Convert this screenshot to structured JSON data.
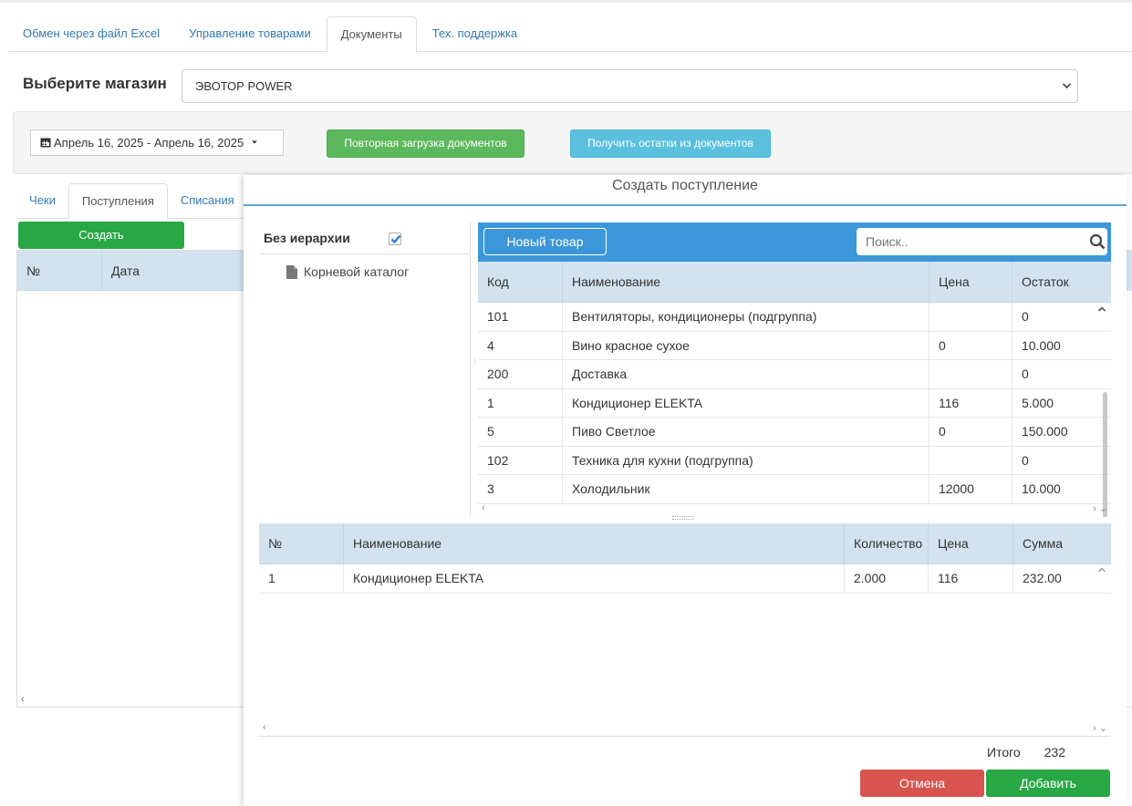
{
  "top_tabs": [
    "Обмен через файл Excel",
    "Управление товарами",
    "Документы",
    "Тех. поддержка"
  ],
  "shop": {
    "label": "Выберите магазин",
    "selected": "ЭВОТОР POWER"
  },
  "filter": {
    "date_range": "Апрель 16, 2025 - Апрель 16, 2025",
    "reload_button": "Повторная загрузка документов",
    "stock_button": "Получить остатки из документов"
  },
  "doc_tabs": [
    "Чеки",
    "Поступления",
    "Списания"
  ],
  "create_button": "Создать",
  "left_grid": {
    "columns": [
      "№",
      "Дата"
    ]
  },
  "modal": {
    "title": "Создать поступление",
    "tree": {
      "no_hierarchy": "Без иерархии",
      "root": "Корневой каталог"
    },
    "new_product_button": "Новый товар",
    "search_placeholder": "Поиск..",
    "product_columns": [
      "Код",
      "Наименование",
      "Цена",
      "Остаток"
    ],
    "products": [
      [
        "101",
        "Вентиляторы, кондиционеры (подгруппа)",
        "",
        "0"
      ],
      [
        "4",
        "Вино красное сухое",
        "0",
        "10.000"
      ],
      [
        "200",
        "Доставка",
        "",
        "0"
      ],
      [
        "1",
        "Кондиционер ELEKTA",
        "116",
        "5.000"
      ],
      [
        "5",
        "Пиво Светлое",
        "0",
        "150.000"
      ],
      [
        "102",
        "Техника для кухни (подгруппа)",
        "",
        "0"
      ],
      [
        "3",
        "Холодильник",
        "12000",
        "10.000"
      ]
    ],
    "selected_columns": [
      "№",
      "Наименование",
      "Количество",
      "Цена",
      "Сумма"
    ],
    "selected_rows": [
      [
        "1",
        "Кондиционер ELEKTA",
        "2.000",
        "116",
        "232.00"
      ]
    ],
    "total_label": "Итого",
    "total_value": "232",
    "cancel_button": "Отмена",
    "add_button": "Добавить"
  },
  "colors": {
    "primary": "#3b97d9",
    "success": "#28a745",
    "danger": "#d9534f",
    "info": "#5bc0de",
    "header_bg": "#d2e3ef"
  }
}
